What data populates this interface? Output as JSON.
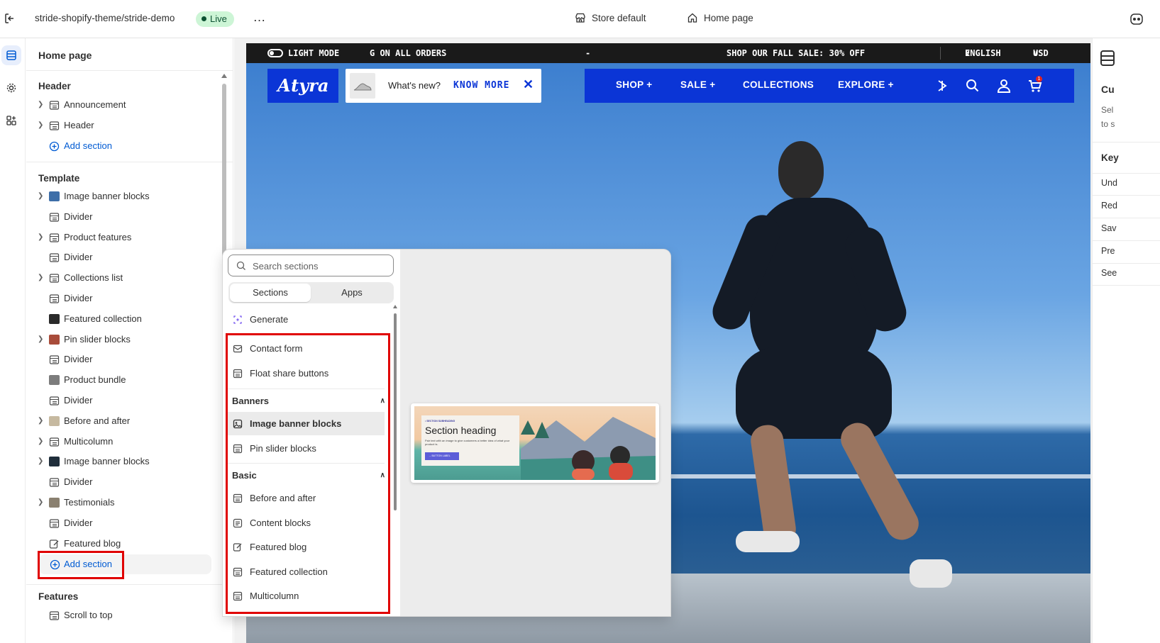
{
  "topbar": {
    "store_path": "stride-shopify-theme/stride-demo",
    "status": "Live",
    "more": "…",
    "context": "Store default",
    "page": "Home page"
  },
  "sidebar": {
    "title": "Home page",
    "header_group": {
      "title": "Header",
      "items": [
        "Announcement",
        "Header"
      ],
      "add": "Add section"
    },
    "template_group": {
      "title": "Template",
      "items": [
        "Image banner blocks",
        "Divider",
        "Product features",
        "Divider",
        "Collections list",
        "Divider",
        "Featured collection",
        "Pin slider blocks",
        "Divider",
        "Product bundle",
        "Divider",
        "Before and after",
        "Multicolumn",
        "Image banner blocks",
        "Divider",
        "Testimonials",
        "Divider",
        "Featured blog"
      ],
      "add": "Add section"
    },
    "features_group": {
      "title": "Features",
      "items": [
        "Scroll to top"
      ]
    }
  },
  "site": {
    "announcement": {
      "light_mode": "LIGHT MODE",
      "marquee_left": "G ON ALL ORDERS",
      "dash": "-",
      "sale": "SHOP OUR FALL SALE: 30% OFF",
      "language": "ENGLISH",
      "currency": "USD $"
    },
    "logo": "Аtyra",
    "whats_new": "What's new?",
    "know_more": "KNOW MORE",
    "close": "✕",
    "nav": {
      "shop": "SHOP +",
      "sale": "SALE +",
      "collections": "COLLECTIONS",
      "explore": "EXPLORE +"
    },
    "cart_count": "1"
  },
  "picker": {
    "search_placeholder": "Search sections",
    "tabs": [
      "Sections",
      "Apps"
    ],
    "generate": "Generate",
    "top_items": [
      "Contact form",
      "Float share buttons"
    ],
    "banners_title": "Banners",
    "banners": [
      "Image banner blocks",
      "Pin slider blocks"
    ],
    "basic_title": "Basic",
    "basic": [
      "Before and after",
      "Content blocks",
      "Featured blog",
      "Featured collection",
      "Multicolumn"
    ],
    "preview": {
      "eyebrow": "• SECTION SUBHEADING",
      "heading": "Section heading",
      "text": "Pair text with an image to give customers a better idea of what your product is.",
      "button": "→ BUTTON LABEL"
    }
  },
  "rightpanel": {
    "title": "Cu",
    "desc1": "Sel",
    "desc2": "to s",
    "shortcuts_title": "Key",
    "rows": [
      "Und",
      "Red",
      "Sav",
      "Pre",
      "See"
    ]
  },
  "colors": {
    "brand_blue": "#0b35d6",
    "highlight_red": "#e00000",
    "live_green": "#cdf5d6",
    "link_blue": "#005bd3"
  }
}
